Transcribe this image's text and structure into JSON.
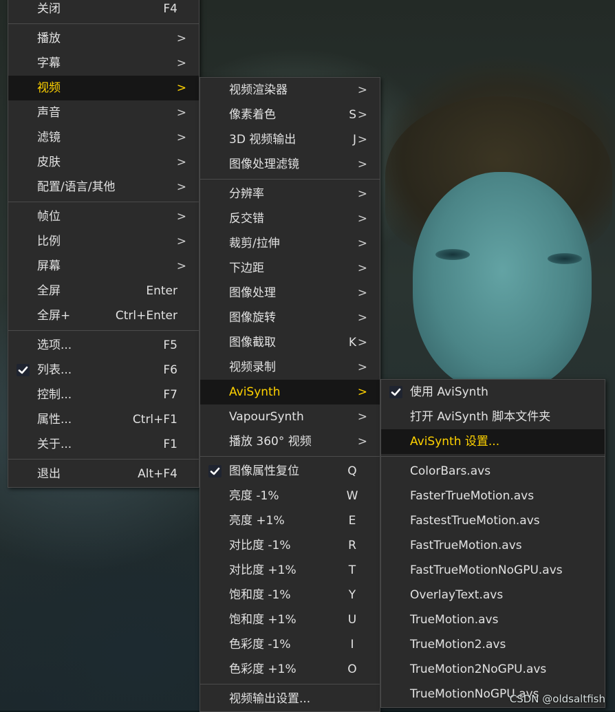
{
  "menu_main": [
    {
      "label": "关闭",
      "shortcut": "F4"
    },
    {
      "sep": true
    },
    {
      "label": "播放",
      "arrow": ">"
    },
    {
      "label": "字幕",
      "arrow": ">"
    },
    {
      "label": "视频",
      "arrow": ">",
      "selected": true
    },
    {
      "label": "声音",
      "arrow": ">"
    },
    {
      "label": "滤镜",
      "arrow": ">"
    },
    {
      "label": "皮肤",
      "arrow": ">"
    },
    {
      "label": "配置/语言/其他",
      "arrow": ">"
    },
    {
      "sep": true
    },
    {
      "label": "帧位",
      "arrow": ">"
    },
    {
      "label": "比例",
      "arrow": ">"
    },
    {
      "label": "屏幕",
      "arrow": ">"
    },
    {
      "label": "全屏",
      "shortcut": "Enter"
    },
    {
      "label": "全屏+",
      "shortcut": "Ctrl+Enter"
    },
    {
      "sep": true
    },
    {
      "label": "选项...",
      "shortcut": "F5"
    },
    {
      "label": "列表...",
      "shortcut": "F6",
      "checked": true
    },
    {
      "label": "控制...",
      "shortcut": "F7"
    },
    {
      "label": "属性...",
      "shortcut": "Ctrl+F1"
    },
    {
      "label": "关于...",
      "shortcut": "F1"
    },
    {
      "sep": true
    },
    {
      "label": "退出",
      "shortcut": "Alt+F4"
    }
  ],
  "menu_video": [
    {
      "label": "视频渲染器",
      "arrow": ">"
    },
    {
      "label": "像素着色",
      "shortcut": "S",
      "arrow": ">"
    },
    {
      "label": "3D 视频输出",
      "shortcut": "J",
      "arrow": ">"
    },
    {
      "label": "图像处理滤镜",
      "arrow": ">"
    },
    {
      "sep": true
    },
    {
      "label": "分辨率",
      "arrow": ">"
    },
    {
      "label": "反交错",
      "arrow": ">"
    },
    {
      "label": "裁剪/拉伸",
      "arrow": ">"
    },
    {
      "label": "下边距",
      "arrow": ">"
    },
    {
      "label": "图像处理",
      "arrow": ">"
    },
    {
      "label": "图像旋转",
      "arrow": ">"
    },
    {
      "label": "图像截取",
      "shortcut": "K",
      "arrow": ">"
    },
    {
      "label": "视频录制",
      "arrow": ">"
    },
    {
      "label": "AviSynth",
      "arrow": ">",
      "selected": true
    },
    {
      "label": "VapourSynth",
      "arrow": ">"
    },
    {
      "label": "播放 360° 视频",
      "arrow": ">"
    },
    {
      "sep": true
    },
    {
      "label": "图像属性复位",
      "shortcut": "Q",
      "checked": true
    },
    {
      "label": "亮度 -1%",
      "shortcut": "W"
    },
    {
      "label": "亮度 +1%",
      "shortcut": "E"
    },
    {
      "label": "对比度 -1%",
      "shortcut": "R"
    },
    {
      "label": "对比度 +1%",
      "shortcut": "T"
    },
    {
      "label": "饱和度 -1%",
      "shortcut": "Y"
    },
    {
      "label": "饱和度 +1%",
      "shortcut": "U"
    },
    {
      "label": "色彩度 -1%",
      "shortcut": "I"
    },
    {
      "label": "色彩度 +1%",
      "shortcut": "O"
    },
    {
      "sep": true
    },
    {
      "label": "视频输出设置..."
    }
  ],
  "menu_avisynth": [
    {
      "label": "使用 AviSynth",
      "checked": true
    },
    {
      "label": "打开 AviSynth 脚本文件夹"
    },
    {
      "label": "AviSynth 设置...",
      "selected": true
    },
    {
      "sep": true
    },
    {
      "label": "ColorBars.avs"
    },
    {
      "label": "FasterTrueMotion.avs"
    },
    {
      "label": "FastestTrueMotion.avs"
    },
    {
      "label": "FastTrueMotion.avs"
    },
    {
      "label": "FastTrueMotionNoGPU.avs"
    },
    {
      "label": "OverlayText.avs"
    },
    {
      "label": "TrueMotion.avs"
    },
    {
      "label": "TrueMotion2.avs"
    },
    {
      "label": "TrueMotion2NoGPU.avs"
    },
    {
      "label": "TrueMotionNoGPU.avs"
    }
  ],
  "watermark": "CSDN @oldsaltfish",
  "colors": {
    "menu_bg": "#2b2b2b",
    "selected_bg": "#161616",
    "selected_text": "#ffd200",
    "text": "#e2e2e2"
  }
}
